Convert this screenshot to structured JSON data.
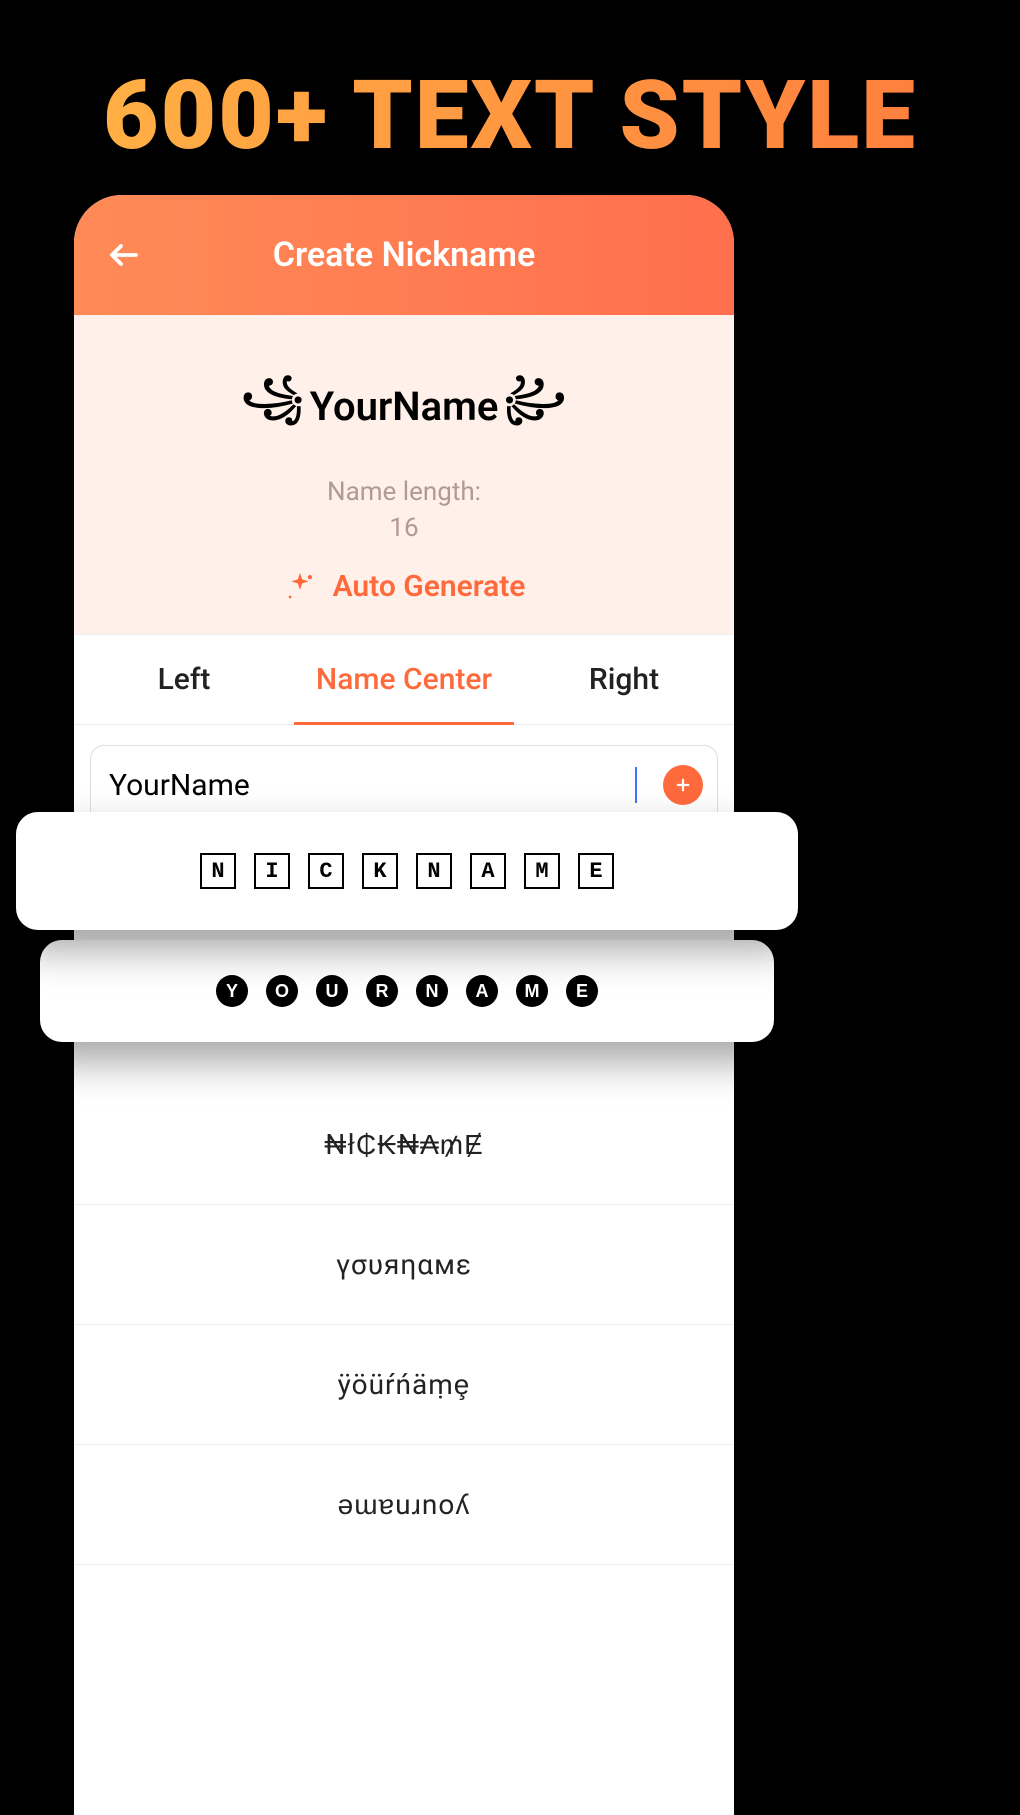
{
  "promo": {
    "title": "600+ TEXT STYLE"
  },
  "header": {
    "title": "Create Nickname"
  },
  "preview": {
    "left_flourish": "꧁",
    "name": "YourName",
    "right_flourish": "꧂",
    "length_label": "Name length:",
    "length_value": "16",
    "auto_generate_label": "Auto Generate"
  },
  "tabs": {
    "left": "Left",
    "center": "Name Center",
    "right": "Right"
  },
  "input": {
    "value": "YourName"
  },
  "overlays": {
    "boxed_letters": [
      "N",
      "I",
      "C",
      "K",
      "N",
      "A",
      "M",
      "E"
    ],
    "circle_letters": [
      "Y",
      "O",
      "U",
      "R",
      "N",
      "A",
      "M",
      "E"
    ]
  },
  "styles": {
    "row1": "₦ł₵₭₦₳₥Ɇ",
    "row2": "γσυяηαмε",
    "row3": "ÿöüŕńäṃȩ",
    "row4": "ǝɯɐuɹnoʎ"
  },
  "icons": {
    "back": "back-arrow-icon",
    "sparkle": "sparkle-icon",
    "add": "plus-icon"
  }
}
